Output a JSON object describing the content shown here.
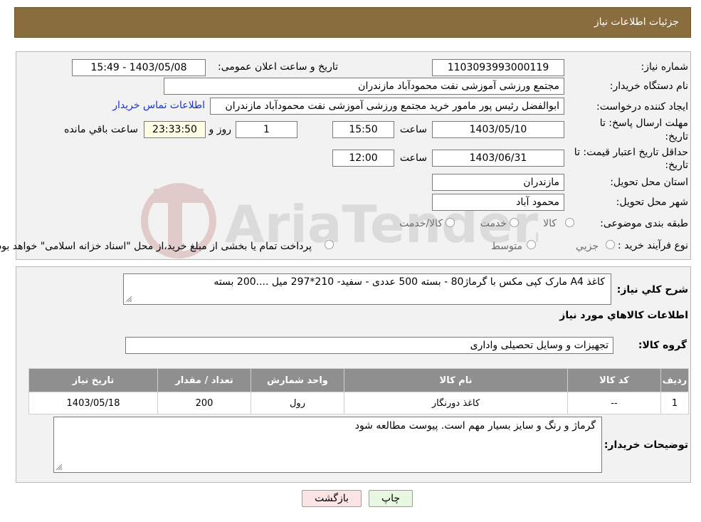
{
  "header": {
    "title": "جزئیات اطلاعات نیاز"
  },
  "need": {
    "number_label": "شماره نیاز:",
    "number_value": "1103093993000119",
    "announce_label": "تاریخ و ساعت اعلان عمومی:",
    "announce_value": "1403/05/08 - 15:49",
    "buyer_org_label": "نام دستگاه خریدار:",
    "buyer_org_value": "مجتمع ورزشی آموزشی نفت محمودآباد مازندران",
    "creator_label": "ایجاد کننده درخواست:",
    "creator_value": "ابوالفضل رئیس پور مامور خرید مجتمع ورزشی آموزشی نفت محمودآباد مازندران",
    "contact_link": "اطلاعات تماس خریدار",
    "deadline_label_1": "مهلت ارسال پاسخ: تا",
    "deadline_label_2": "تاریخ:",
    "deadline_date": "1403/05/10",
    "time_label": "ساعت",
    "deadline_time": "15:50",
    "days_value": "1",
    "days_label": "روز و",
    "remaining_value": "23:33:50",
    "remaining_label": "ساعت باقي مانده",
    "validity_label_1": "حداقل تاریخ اعتبار قیمت: تا",
    "validity_label_2": "تاریخ:",
    "validity_date": "1403/06/31",
    "validity_time": "12:00",
    "province_label": "استان محل تحویل:",
    "province_value": "مازندران",
    "city_label": "شهر محل تحویل:",
    "city_value": "محمود آباد",
    "category_label": "طبقه بندی موضوعی:",
    "category_options": [
      "کالا",
      "خدمت",
      "کالا/خدمت"
    ],
    "process_label": "نوع فرآیند خرید :",
    "process_options": [
      "جزیي",
      "متوسط"
    ],
    "process_note": "پرداخت تمام یا بخشی از مبلغ خرید،از محل \"اسناد خزانه اسلامی\" خواهد بود."
  },
  "details": {
    "desc_label": "شرح کلي نیاز:",
    "desc_value": "کاغذ A4  مارک کپی مکس با گرماژ80 - بسته 500 عددی - سفید- 210*297 میل ....200 بسته",
    "items_title": "اطلاعات کالاهاي مورد نیاز",
    "group_label": "گروه کالا:",
    "group_value": "تجهیزات و وسایل تحصیلی واداری",
    "table": {
      "headers": [
        "ردیف",
        "کد کالا",
        "نام کالا",
        "واحد شمارش",
        "تعداد / مقدار",
        "تاریخ نیاز"
      ],
      "rows": [
        [
          "1",
          "--",
          "کاغذ دورنگار",
          "رول",
          "200",
          "1403/05/18"
        ]
      ]
    },
    "notes_label": "توضیحات خریدار:",
    "notes_value": "گرماژ و رنگ و سایز بسیار مهم است. پیوست مطالعه شود"
  },
  "buttons": {
    "print": "چاپ",
    "back": "بازگشت"
  },
  "colors": {
    "header_bg": "#8a6d3f",
    "table_header_bg": "#8f8f8f",
    "back_btn_bg": "#fde4e4",
    "print_btn_bg": "#e8f8e0"
  }
}
